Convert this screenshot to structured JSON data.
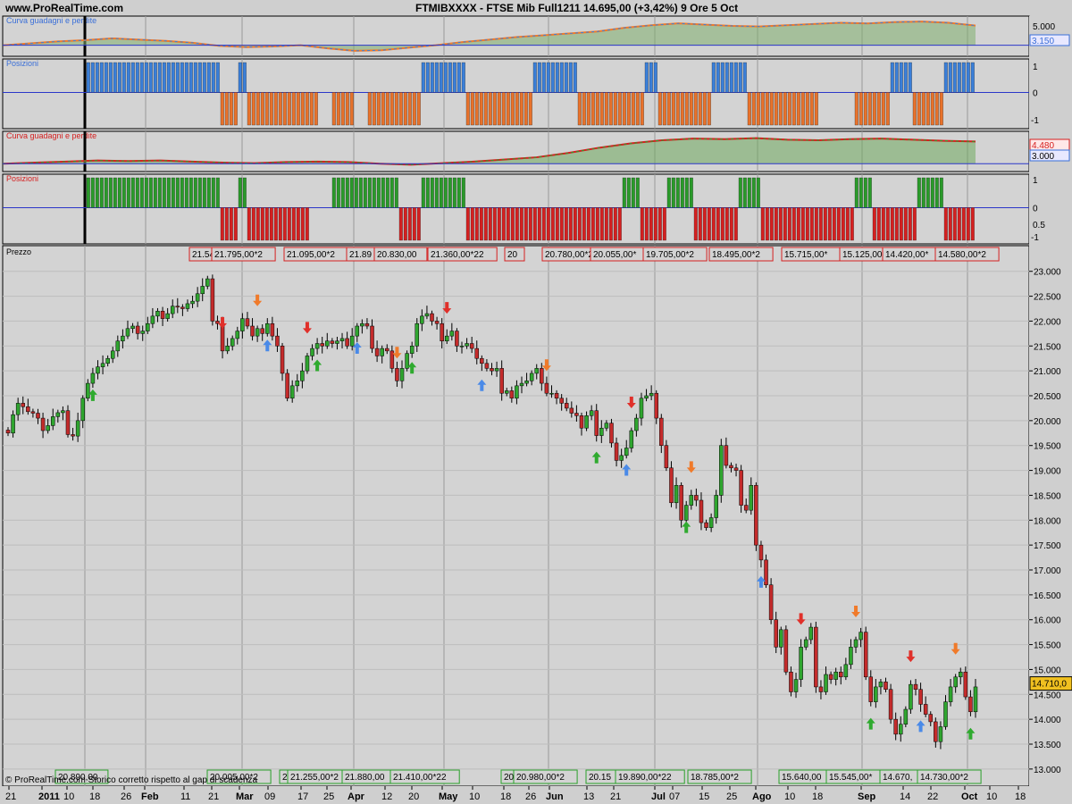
{
  "header": {
    "site": "www.ProRealTime.com",
    "title": "FTMIBXXXX - FTSE Mib Full1211   14.695,00 (+3,42%)   9 Ore  5 Oct"
  },
  "panels": {
    "equity1": {
      "label": "Curva guadagni e perdite",
      "ticks": [
        "5.000"
      ],
      "current": "3.150"
    },
    "positions1": {
      "label": "Posizioni",
      "ticks": [
        "1",
        "0",
        "-1"
      ]
    },
    "equity2": {
      "label": "Curva guadagni e perdite",
      "ticks": [
        "4.480",
        "3.000"
      ]
    },
    "positions2": {
      "label": "Posizioni",
      "ticks": [
        "1",
        "0",
        "0.5",
        "-1"
      ]
    },
    "price": {
      "label": "Prezzo",
      "current": "14.710,0"
    }
  },
  "footer": {
    "copyright": "© ProRealTime.com Storico corretto rispetto al gap di scadenza"
  },
  "colors": {
    "bull": "#2fa52f",
    "bear": "#c42b2b",
    "long_bar": "#3a7fd9",
    "short_bar": "#e8722b",
    "long_bar2": "#2a9a2a",
    "short_bar2": "#d42020",
    "blue_line": "#2a36c9",
    "frame": "#000000"
  },
  "chart_data": [
    {
      "type": "candlestick",
      "panel": "Prezzo",
      "y_axis_ticks": [
        "23.000",
        "22.500",
        "22.000",
        "21.500",
        "21.000",
        "20.500",
        "20.000",
        "19.500",
        "19.000",
        "18.500",
        "18.000",
        "17.500",
        "17.000",
        "16.500",
        "16.000",
        "15.500",
        "15.000",
        "14.500",
        "14.000",
        "13.500",
        "13.000"
      ],
      "ylim": [
        12800,
        23300
      ],
      "x_axis_labels": [
        "21",
        "2011",
        "10",
        "18",
        "26",
        "Feb",
        "11",
        "21",
        "Mar",
        "09",
        "17",
        "25",
        "Apr",
        "12",
        "20",
        "May",
        "10",
        "18",
        "26",
        "Jun",
        "13",
        "21",
        "Jul",
        "07",
        "15",
        "25",
        "Ago",
        "10",
        "18",
        "Sep",
        "14",
        "22",
        "Oct",
        "10",
        "18"
      ],
      "x_axis_bold": [
        "2011",
        "Feb",
        "Mar",
        "Apr",
        "May",
        "Jun",
        "Jul",
        "Ago",
        "Sep",
        "Oct"
      ],
      "closes": [
        19750,
        20120,
        20350,
        20280,
        20180,
        20150,
        20050,
        19800,
        19900,
        20080,
        20160,
        20200,
        19720,
        19690,
        20000,
        20450,
        20750,
        20950,
        21080,
        21150,
        21250,
        21400,
        21600,
        21700,
        21850,
        21900,
        21750,
        21800,
        21950,
        22100,
        22200,
        22050,
        22150,
        22300,
        22280,
        22250,
        22350,
        22400,
        22550,
        22700,
        22850,
        22000,
        21950,
        21400,
        21500,
        21650,
        21800,
        22050,
        21900,
        21700,
        21850,
        21750,
        21950,
        21700,
        21500,
        20950,
        20450,
        20700,
        20800,
        21000,
        21300,
        21450,
        21550,
        21500,
        21600,
        21550,
        21600,
        21650,
        21500,
        21700,
        21900,
        21950,
        21900,
        21450,
        21300,
        21450,
        21400,
        21050,
        20800,
        21050,
        21350,
        21500,
        21950,
        22100,
        22150,
        22000,
        21950,
        21600,
        21700,
        21800,
        21500,
        21500,
        21550,
        21450,
        21250,
        21150,
        21050,
        21000,
        21050,
        20550,
        20600,
        20450,
        20700,
        20750,
        20800,
        20950,
        21050,
        20750,
        20550,
        20550,
        20450,
        20350,
        20250,
        20150,
        20100,
        19850,
        20100,
        20200,
        19700,
        19850,
        19950,
        19550,
        19200,
        19300,
        19450,
        19800,
        20050,
        20450,
        20500,
        20550,
        20050,
        19500,
        19050,
        18350,
        18700,
        18000,
        18300,
        18500,
        18400,
        17950,
        17850,
        18050,
        18500,
        19500,
        19100,
        19050,
        19000,
        18300,
        18200,
        18700,
        17500,
        17200,
        16700,
        16000,
        15450,
        15800,
        14950,
        14550,
        14800,
        15450,
        15600,
        15850,
        14650,
        14550,
        14900,
        14800,
        14950,
        14850,
        15100,
        15450,
        15600,
        15750,
        14850,
        14350,
        14650,
        14750,
        14600,
        14000,
        13700,
        13900,
        14200,
        14700,
        14600,
        14300,
        14100,
        13950,
        13550,
        13850,
        14350,
        14650,
        14850,
        14950,
        14450,
        14150,
        14650
      ],
      "current_price": 14710,
      "trade_labels_top": [
        "21.54",
        "21.795,00*2",
        "21.095,00*2",
        "21.89",
        "20.830,00",
        "21.360,00*22",
        "20",
        "20.780,00*2",
        "20.055,00*",
        "19.705,00*2",
        "18.495,00*2",
        "15.715,00*",
        "15.125,00",
        "14.420,00*",
        "14.580,00*2"
      ],
      "trade_labels_bottom": [
        "20.890,00",
        "20.005,00*2",
        "2",
        "21.255,00*2",
        "21.880,00",
        "21.410,00*22",
        "20",
        "20.980,00*2",
        "20.15",
        "19.890,00*22",
        "18.785,00*2",
        "15.640,00",
        "15.545,00*",
        "14.670,",
        "14.730,00*2"
      ]
    },
    {
      "type": "area",
      "panel": "Curva guadagni e perdite (1)",
      "series": [
        {
          "values": [
            0,
            300,
            600,
            800,
            1100,
            900,
            700,
            400,
            -100,
            -300,
            -200,
            0,
            -500,
            -900,
            -800,
            -400,
            0,
            500,
            900,
            1300,
            1600,
            1900,
            2200,
            2800,
            3200,
            3500,
            3300,
            3100,
            3000,
            3200,
            3400,
            3600,
            3500,
            3700,
            3800,
            3600,
            3150
          ]
        }
      ]
    },
    {
      "type": "area",
      "panel": "Curva guadagni e perdite (2)",
      "series": [
        {
          "values": [
            2400,
            2500,
            2600,
            2700,
            2650,
            2700,
            2600,
            2500,
            2450,
            2550,
            2600,
            2550,
            2400,
            2300,
            2450,
            2600,
            2800,
            3000,
            3400,
            3900,
            4300,
            4600,
            4750,
            4700,
            4800,
            4650,
            4600,
            4700,
            4750,
            4650,
            4550,
            4480
          ]
        }
      ]
    }
  ]
}
